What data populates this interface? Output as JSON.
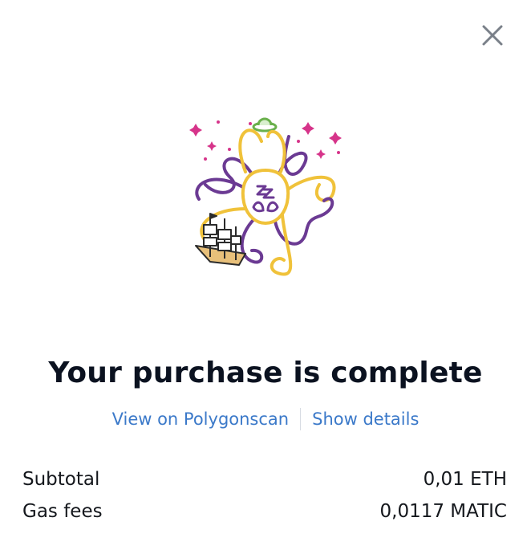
{
  "dialog": {
    "close_icon": "close-icon",
    "illustration_icon": "octopus-illustration",
    "title": "Your purchase is complete",
    "links": {
      "view_explorer": "View on Polygonscan",
      "show_details": "Show details"
    },
    "summary": [
      {
        "label": "Subtotal",
        "value": "0,01 ETH"
      },
      {
        "label": "Gas fees",
        "value": "0,0117 MATIC"
      }
    ]
  },
  "colors": {
    "title": "#0b1220",
    "link": "#3b79c9",
    "illustration_purple": "#6b3a93",
    "illustration_yellow": "#f0c23a",
    "illustration_pink": "#d6348a",
    "illustration_green": "#6ab04c"
  }
}
